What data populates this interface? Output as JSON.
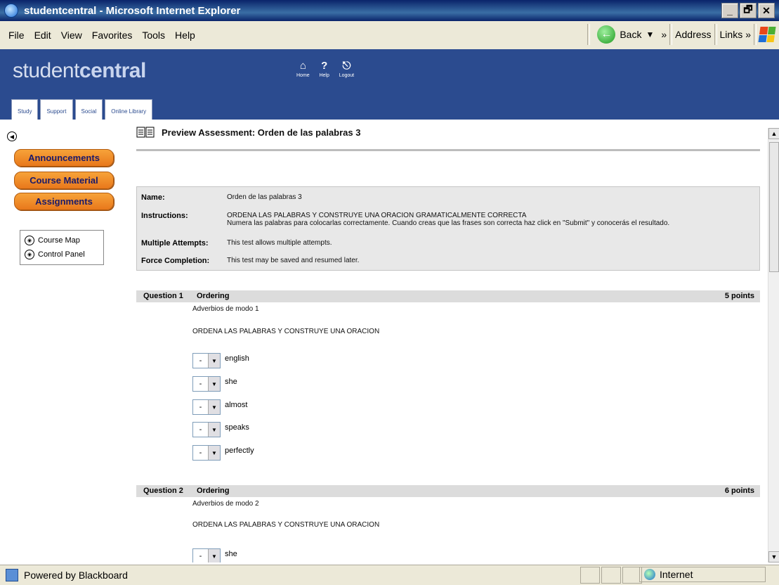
{
  "window": {
    "title": "studentcentral - Microsoft Internet Explorer",
    "controls": [
      "_",
      "🗗",
      "✕"
    ]
  },
  "menubar": {
    "items": [
      "File",
      "Edit",
      "View",
      "Favorites",
      "Tools",
      "Help"
    ],
    "back_label": "Back",
    "chevron1": "»",
    "address_label": "Address",
    "links_label": "Links",
    "chevron2": "»"
  },
  "header": {
    "logo_plain": "student",
    "logo_bold": "central",
    "toplinks": [
      {
        "label": "Home",
        "icon": "home-icon"
      },
      {
        "label": "Help",
        "icon": "help-icon"
      },
      {
        "label": "Logout",
        "icon": "logout-icon"
      }
    ],
    "tabs": [
      "Study",
      "Support",
      "Social",
      "Online Library"
    ]
  },
  "leftnav": {
    "buttons": [
      "Announcements",
      "Course Material",
      "Assignments"
    ],
    "tools": [
      "Course Map",
      "Control Panel"
    ]
  },
  "page": {
    "title": "Preview Assessment: Orden de las palabras 3",
    "info": {
      "name_label": "Name:",
      "name_value": "Orden de las palabras 3",
      "instructions_label": "Instructions:",
      "instructions_line1": "ORDENA LAS PALABRAS Y CONSTRUYE UNA ORACION GRAMATICALMENTE CORRECTA",
      "instructions_line2": "Numera las palabras para colocarlas correctamente. Cuando creas que las frases son correcta haz click en \"Submit\" y conocerás el resultado.",
      "multiple_label": "Multiple Attempts:",
      "multiple_value": "This test allows multiple attempts.",
      "force_label": "Force Completion:",
      "force_value": "This test may be saved and resumed later."
    },
    "questions": [
      {
        "number": "Question 1",
        "type": "Ordering",
        "points": "5 points",
        "subtitle": "Adverbios de modo 1",
        "prompt": "ORDENA LAS PALABRAS Y CONSTRUYE UNA ORACION",
        "items": [
          {
            "value": "-",
            "word": "english"
          },
          {
            "value": "-",
            "word": "she"
          },
          {
            "value": "-",
            "word": "almost"
          },
          {
            "value": "-",
            "word": "speaks"
          },
          {
            "value": "-",
            "word": "perfectly"
          }
        ]
      },
      {
        "number": "Question 2",
        "type": "Ordering",
        "points": "6 points",
        "subtitle": "Adverbios de modo 2",
        "prompt": "ORDENA LAS PALABRAS Y CONSTRUYE UNA ORACION",
        "items": [
          {
            "value": "-",
            "word": "she"
          }
        ]
      }
    ]
  },
  "statusbar": {
    "text": "Powered by Blackboard",
    "zone": "Internet"
  },
  "colors": {
    "header_bg": "#2b4b8f",
    "nav_button": "#e8781b",
    "info_bg": "#e8e8e8"
  }
}
